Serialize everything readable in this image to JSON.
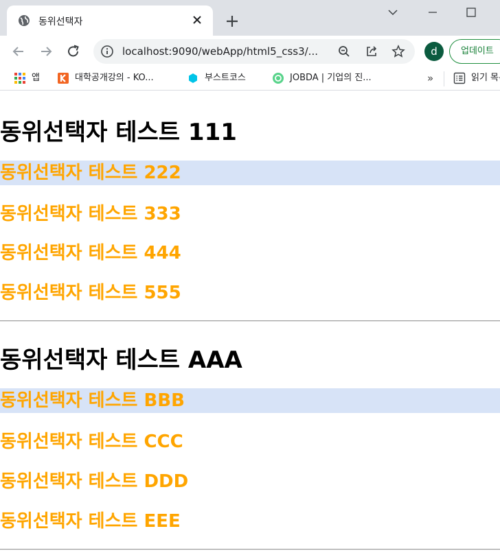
{
  "browser": {
    "tab_title": "동위선택자",
    "url": "localhost:9090/webApp/html5_css3/...",
    "avatar_letter": "d",
    "update_label": "업데이트",
    "bookmarks": [
      {
        "label": "앱",
        "icon": "apps-grid-icon"
      },
      {
        "label": "대학공개강의 - KO...",
        "icon": "kocw-icon"
      },
      {
        "label": "부스트코스",
        "icon": "boostcourse-icon"
      },
      {
        "label": "JOBDA | 기업의 진...",
        "icon": "jobda-icon"
      }
    ],
    "more_label": "»",
    "reading_list_label": "읽기 목록"
  },
  "page": {
    "group1": {
      "heading": "동위선택자 테스트 111",
      "items": [
        "동위선택자 테스트 222",
        "동위선택자 테스트 333",
        "동위선택자 테스트 444",
        "동위선택자 테스트 555"
      ]
    },
    "group2": {
      "heading": "동위선택자 테스트 AAA",
      "items": [
        "동위선택자 테스트 BBB",
        "동위선택자 테스트 CCC",
        "동위선택자 테스트 DDD",
        "동위선택자 테스트 EEE"
      ]
    }
  },
  "colors": {
    "heading": "#000000",
    "sibling_text": "#ffa500",
    "adjacent_highlight": "#d7e3f7"
  }
}
